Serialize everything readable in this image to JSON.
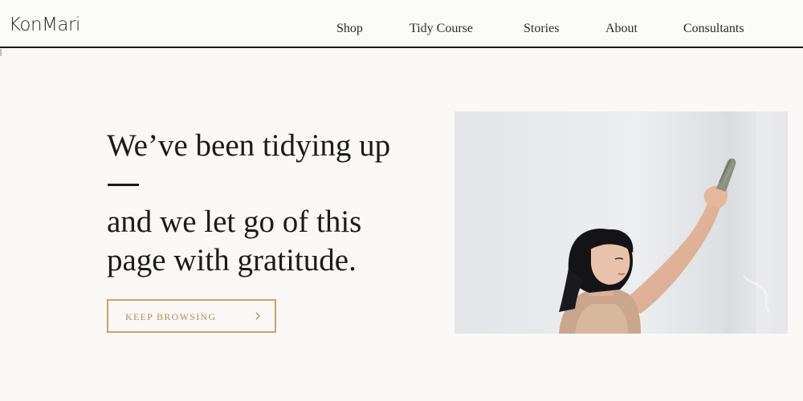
{
  "header": {
    "logo": "KonMari",
    "nav": [
      "Shop",
      "Tidy Course",
      "Stories",
      "About",
      "Consultants"
    ]
  },
  "hero": {
    "headline_line1": "We’ve been tidying up",
    "headline_line2a": "and we let go of this",
    "headline_line2b": "page with gratitude.",
    "cta_label": "KEEP BROWSING",
    "cta_icon": "chevron-right-icon"
  },
  "photo": {
    "subject": "woman-raising-sage-bundle"
  },
  "colors": {
    "background": "#faf9f7",
    "text": "#1b1b1b",
    "accent": "#d39f61",
    "accent_text": "#b98a4f"
  }
}
